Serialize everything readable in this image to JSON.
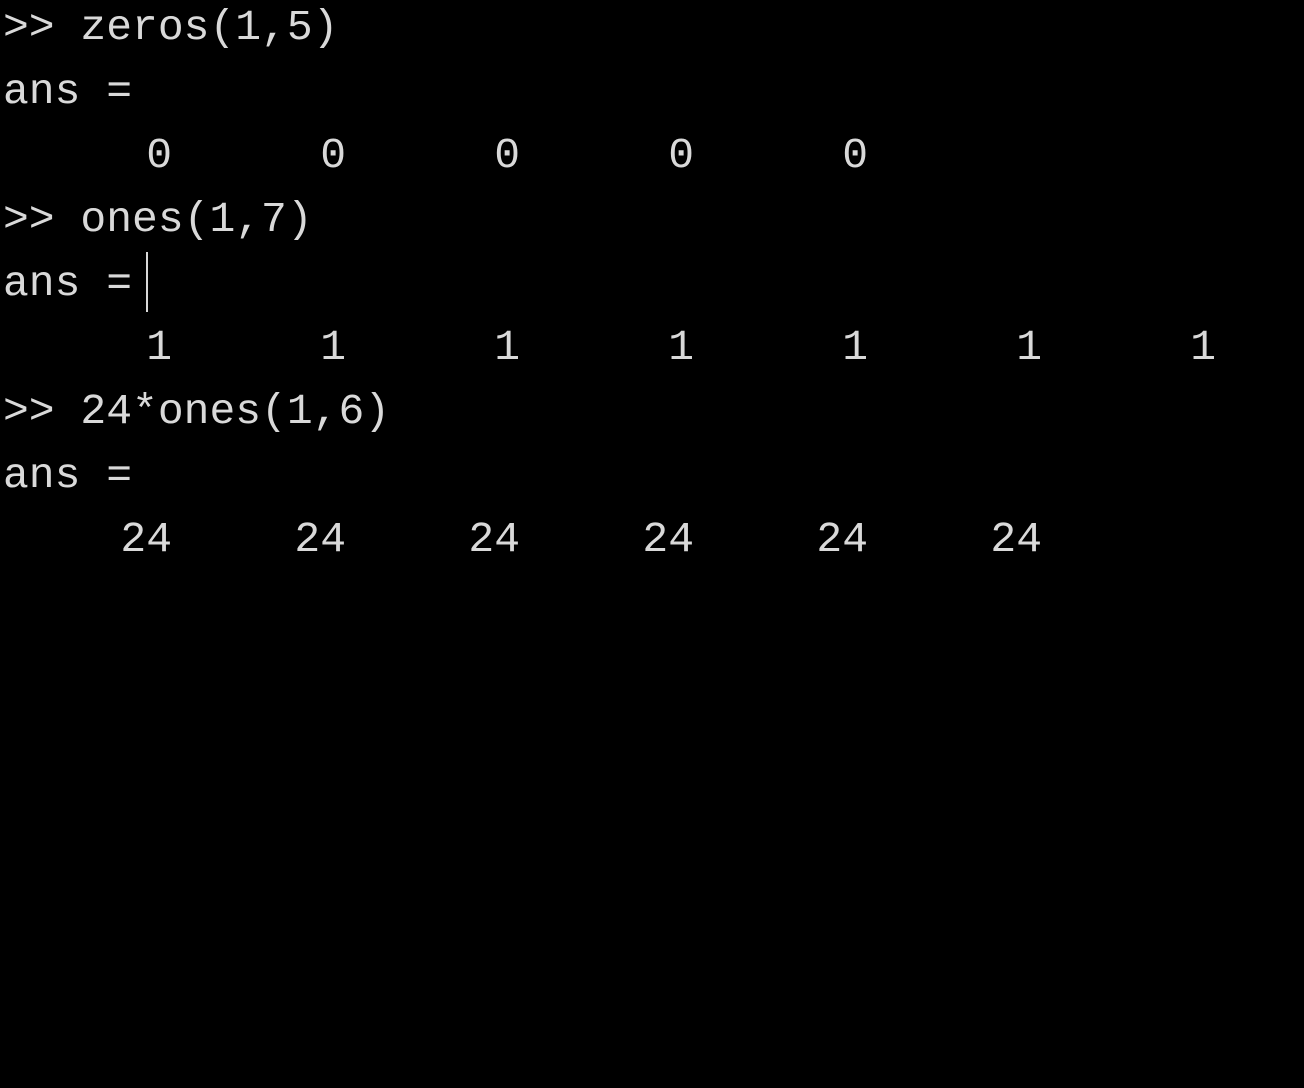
{
  "prompt": ">>",
  "blocks": [
    {
      "command": "zeros(1,5)",
      "result_label": "ans =",
      "values": [
        "0",
        "0",
        "0",
        "0",
        "0"
      ]
    },
    {
      "command": "ones(1,7)",
      "result_label": "ans =",
      "values": [
        "1",
        "1",
        "1",
        "1",
        "1",
        "1",
        "1"
      ]
    },
    {
      "command": "24*ones(1,6)",
      "result_label": "ans =",
      "values": [
        "24",
        "24",
        "24",
        "24",
        "24",
        "24"
      ]
    }
  ],
  "colors": {
    "background": "#000000",
    "text": "#d9d9d9"
  }
}
